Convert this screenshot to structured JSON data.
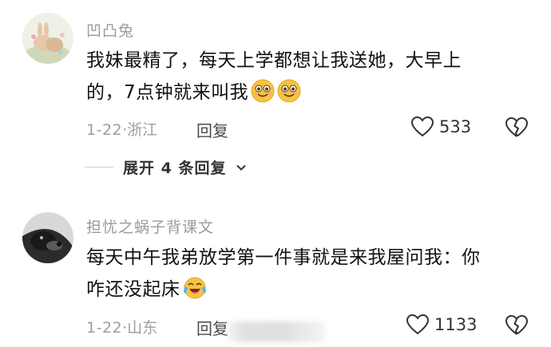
{
  "comments": [
    {
      "username": "凹凸兔",
      "text_line1": "我妹最精了，每天上学都想让我送她，大早上",
      "text_line2": "的，7点钟就来叫我",
      "emoji": "smiling-face",
      "date": "1-22",
      "location": "浙江",
      "meta_sep": "·",
      "reply_label": "回复",
      "likes": "533",
      "expand_label": "展开 4 条回复"
    },
    {
      "username": "担忧之蜗子背课文",
      "text_line1": "每天中午我弟放学第一件事就是来我屋问我：你",
      "text_line2": "咋还没起床",
      "emoji": "laughing-crying-face",
      "date": "1-22",
      "location": "山东",
      "meta_sep": "·",
      "reply_label": "回复",
      "likes": "1133"
    }
  ],
  "colors": {
    "username": "#9b9b9b",
    "text": "#111111",
    "meta": "#9e9e9e",
    "emoji_yellow": "#f6c343"
  }
}
